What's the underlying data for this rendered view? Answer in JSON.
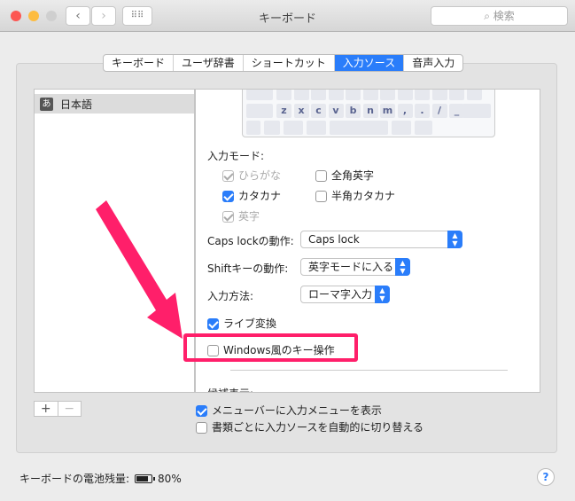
{
  "window": {
    "title": "キーボード",
    "search_placeholder": "検索"
  },
  "tabs": [
    {
      "label": "キーボード",
      "active": false
    },
    {
      "label": "ユーザ辞書",
      "active": false
    },
    {
      "label": "ショートカット",
      "active": false
    },
    {
      "label": "入力ソース",
      "active": true
    },
    {
      "label": "音声入力",
      "active": false
    }
  ],
  "sources": {
    "items": [
      {
        "icon": "あ",
        "label": "日本語",
        "selected": true
      }
    ],
    "add_label": "+",
    "remove_label": "−"
  },
  "keyboard_preview": {
    "row": [
      "z",
      "x",
      "c",
      "v",
      "b",
      "n",
      "m",
      ",",
      ".",
      "/",
      "_"
    ]
  },
  "input_modes": {
    "label": "入力モード:",
    "options": [
      {
        "label": "ひらがな",
        "checked": true,
        "disabled": true
      },
      {
        "label": "全角英字",
        "checked": false,
        "disabled": false
      },
      {
        "label": "カタカナ",
        "checked": true,
        "disabled": false
      },
      {
        "label": "半角カタカナ",
        "checked": false,
        "disabled": false
      },
      {
        "label": "英字",
        "checked": true,
        "disabled": true
      }
    ]
  },
  "caps_lock": {
    "label": "Caps lockの動作:",
    "value": "Caps lock"
  },
  "shift": {
    "label": "Shiftキーの動作:",
    "value": "英字モードに入る"
  },
  "input_method": {
    "label": "入力方法:",
    "value": "ローマ字入力"
  },
  "live_conversion": {
    "label": "ライブ変換",
    "checked": true
  },
  "windows_keys": {
    "label": "Windows風のキー操作",
    "checked": false
  },
  "candidates_label": "候補表示:",
  "show_menu": {
    "label": "メニューバーに入力メニューを表示",
    "checked": true
  },
  "auto_switch": {
    "label": "書類ごとに入力ソースを自動的に切り替える",
    "checked": false
  },
  "battery": {
    "label": "キーボードの電池残量:",
    "value": "80%",
    "level": 0.8
  },
  "help_label": "?",
  "annotation": {
    "color": "#ff1f6a"
  }
}
